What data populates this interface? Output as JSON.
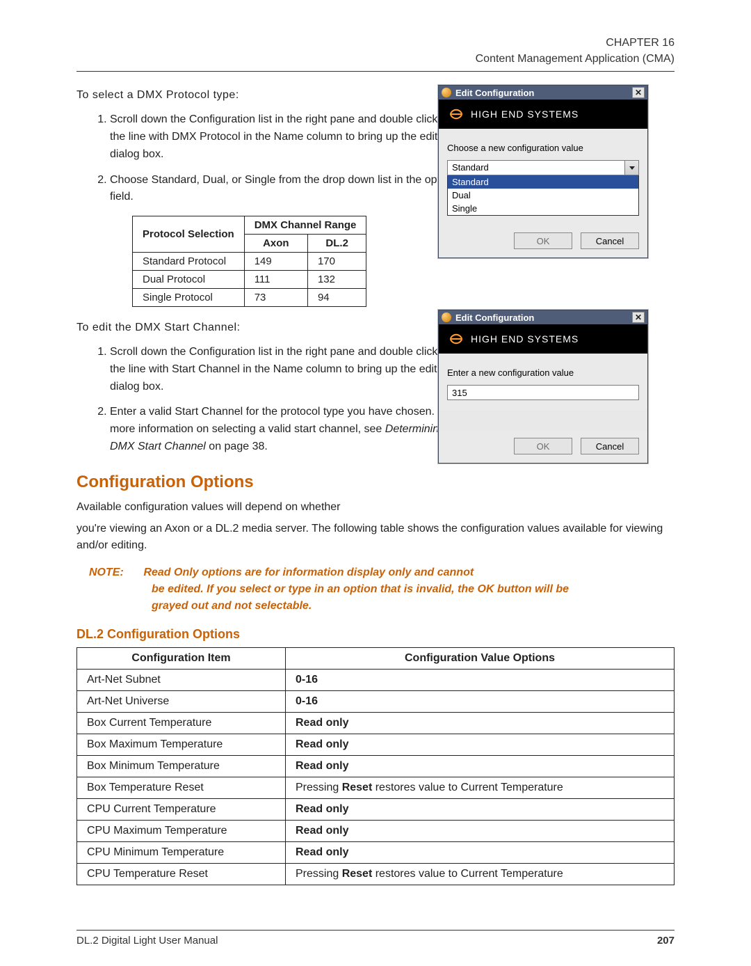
{
  "header": {
    "chapter": "CHAPTER 16",
    "title": "Content Management Application (CMA)"
  },
  "text": {
    "to_select": "To select a DMX Protocol type:",
    "step_a1": "Scroll down the Configuration list in the right pane and double click on the line with DMX Protocol in the Name column to bring up the edit dialog box.",
    "step_a2": "Choose Standard, Dual, or Single from the drop down list in the option field.",
    "to_edit": "To edit the DMX Start Channel:",
    "step_b1": "Scroll down the Configuration list in the right pane and double click on the line with Start Channel in the Name column to bring up the edit dialog box.",
    "step_b2_a": "Enter a valid Start Channel for the protocol type you have chosen. For more information on selecting a valid start channel, see ",
    "step_b2_em": "Determining a DMX Start Channel",
    "step_b2_b": " on page 38.",
    "section": "Configuration Options",
    "para1": "Available configuration values will depend on whether",
    "para2": "you're viewing an Axon or a DL.2 media server. The following table shows the configuration values available for viewing and/or editing.",
    "note_label": "NOTE:",
    "note_text": "Read Only options are for information display only and cannot be edited. If you select or type in an option that is invalid, the OK button will be grayed out and not selectable.",
    "sub_section": "DL.2 Configuration Options"
  },
  "proto_table": {
    "head1": "Protocol Selection",
    "head2": "DMX Channel Range",
    "sub1": "Axon",
    "sub2": "DL.2",
    "rows": [
      {
        "name": "Standard Protocol",
        "axon": "149",
        "dl2": "170"
      },
      {
        "name": "Dual Protocol",
        "axon": "111",
        "dl2": "132"
      },
      {
        "name": "Single Protocol",
        "axon": "73",
        "dl2": "94"
      }
    ]
  },
  "config_table": {
    "head1": "Configuration Item",
    "head2": "Configuration Value Options",
    "rows": [
      {
        "item": "Art-Net Subnet",
        "value_bold": "0-16",
        "value_plain": ""
      },
      {
        "item": "Art-Net Universe",
        "value_bold": "0-16",
        "value_plain": ""
      },
      {
        "item": "Box Current Temperature",
        "value_bold": "Read only",
        "value_plain": ""
      },
      {
        "item": "Box Maximum Temperature",
        "value_bold": "Read only",
        "value_plain": ""
      },
      {
        "item": "Box Minimum Temperature",
        "value_bold": "Read only",
        "value_plain": ""
      },
      {
        "item": "Box Temperature Reset",
        "value_bold": "Reset",
        "value_prefix": "Pressing ",
        "value_suffix": " restores value to Current Temperature"
      },
      {
        "item": "CPU Current Temperature",
        "value_bold": "Read only",
        "value_plain": ""
      },
      {
        "item": "CPU Maximum Temperature",
        "value_bold": "Read only",
        "value_plain": ""
      },
      {
        "item": "CPU Minimum Temperature",
        "value_bold": "Read only",
        "value_plain": ""
      },
      {
        "item": "CPU Temperature Reset",
        "value_bold": "Reset",
        "value_prefix": "Pressing ",
        "value_suffix": " restores value to Current Temperature"
      }
    ]
  },
  "dialog1": {
    "title": "Edit Configuration",
    "brand": "HIGH END SYSTEMS",
    "prompt": "Choose a new configuration value",
    "selected": "Standard",
    "options": [
      "Standard",
      "Dual",
      "Single"
    ],
    "ok": "OK",
    "cancel": "Cancel"
  },
  "dialog2": {
    "title": "Edit Configuration",
    "brand": "HIGH END SYSTEMS",
    "prompt": "Enter a new configuration value",
    "value": "315",
    "ok": "OK",
    "cancel": "Cancel"
  },
  "footer": {
    "left": "DL.2 Digital Light User Manual",
    "page": "207"
  }
}
